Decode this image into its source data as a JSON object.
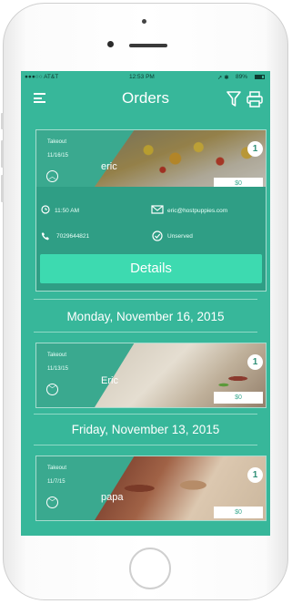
{
  "status_bar": {
    "carrier": "●●●○○ AT&T",
    "time": "12:53 PM",
    "battery": "89%"
  },
  "nav": {
    "title": "Orders",
    "menu_icon": "hamburger-menu-icon",
    "filter_icon": "funnel-filter-icon",
    "print_icon": "printer-icon"
  },
  "orders": [
    {
      "type": "Takeout",
      "date": "11/16/15",
      "customer": "eric",
      "count": "1",
      "price": "$0",
      "time": "11:50 AM",
      "email": "eric@hostpuppies.com",
      "phone": "7029644821",
      "status": "Unserved",
      "details_label": "Details",
      "expanded": true
    },
    {
      "type": "Takeout",
      "date": "11/13/15",
      "customer": "Eric",
      "count": "1",
      "price": "$0"
    },
    {
      "type": "Takeout",
      "date": "11/7/15",
      "customer": "papa",
      "count": "1",
      "price": "$0"
    }
  ],
  "date_headers": [
    "Monday, November 16, 2015",
    "Friday, November 13, 2015"
  ],
  "colors": {
    "screen_bg": "#37b79a",
    "card_bg": "#2f9e85",
    "details_button": "#3ddab0"
  }
}
